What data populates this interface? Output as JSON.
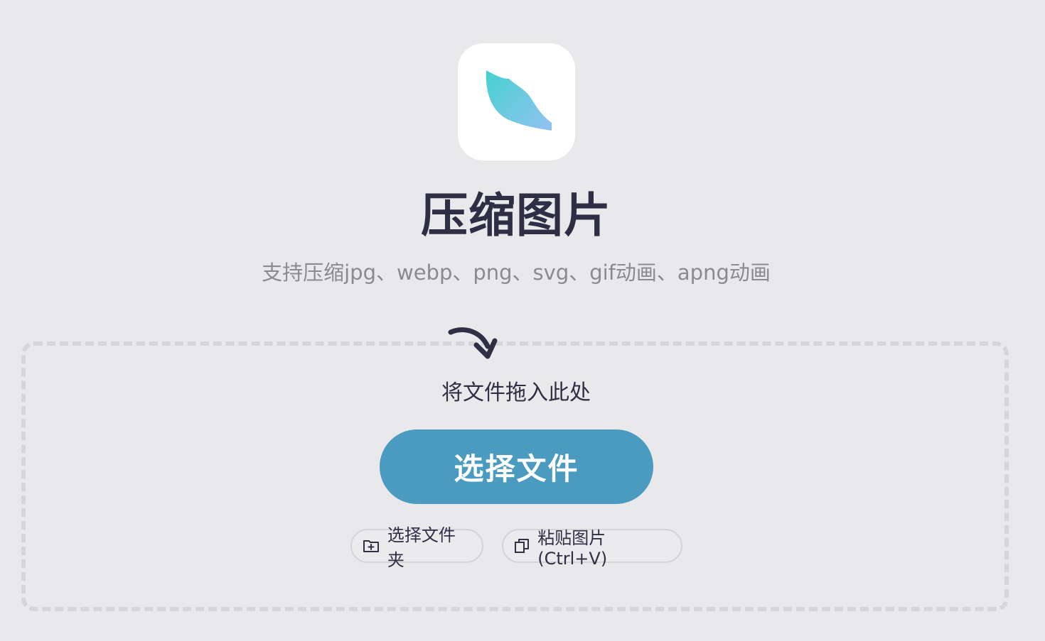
{
  "app": {
    "title": "压缩图片",
    "subtitle": "支持压缩jpg、webp、png、svg、gif动画、apng动画",
    "logo_icon": "leaf-logo-icon",
    "colors": {
      "background": "#e9e9ec",
      "accent": "#4b9abf",
      "logo_gradient_start": "#4dd0d2",
      "logo_gradient_end": "#8fc3ef"
    }
  },
  "dropzone": {
    "hint": "将文件拖入此处",
    "arrow_icon": "curved-arrow-down-icon",
    "select_button_label": "选择文件",
    "folder_button_label": "选择文件夹",
    "folder_icon": "folder-add-icon",
    "paste_button_label": "粘贴图片 (Ctrl+V)",
    "paste_icon": "copy-icon"
  }
}
